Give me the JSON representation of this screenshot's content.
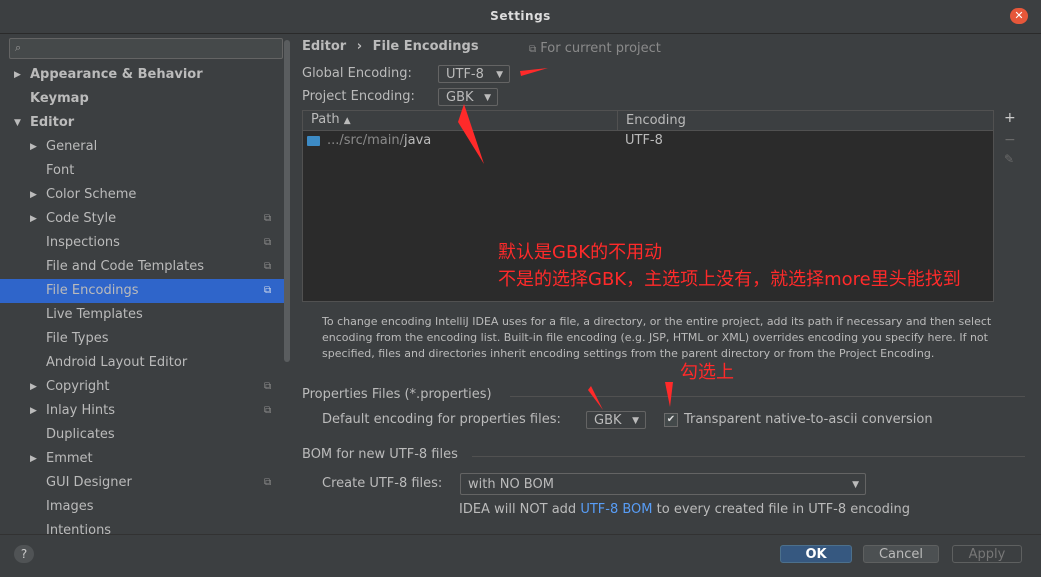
{
  "window": {
    "title": "Settings"
  },
  "sidebar": {
    "items": [
      {
        "label": "Appearance & Behavior"
      },
      {
        "label": "Keymap"
      },
      {
        "label": "Editor"
      },
      {
        "label": "General"
      },
      {
        "label": "Font"
      },
      {
        "label": "Color Scheme"
      },
      {
        "label": "Code Style"
      },
      {
        "label": "Inspections"
      },
      {
        "label": "File and Code Templates"
      },
      {
        "label": "File Encodings"
      },
      {
        "label": "Live Templates"
      },
      {
        "label": "File Types"
      },
      {
        "label": "Android Layout Editor"
      },
      {
        "label": "Copyright"
      },
      {
        "label": "Inlay Hints"
      },
      {
        "label": "Duplicates"
      },
      {
        "label": "Emmet"
      },
      {
        "label": "GUI Designer"
      },
      {
        "label": "Images"
      },
      {
        "label": "Intentions"
      }
    ]
  },
  "breadcrumb": {
    "parent": "Editor",
    "separator": "›",
    "current": "File Encodings",
    "scope": "For current project"
  },
  "global_encoding": {
    "label": "Global Encoding:",
    "value": "UTF-8"
  },
  "project_encoding": {
    "label": "Project Encoding:",
    "value": "GBK"
  },
  "table": {
    "columns": [
      "Path",
      "Encoding"
    ],
    "rows": [
      {
        "path_prefix": ".../src/main/",
        "path_last": "java",
        "encoding": "UTF-8"
      }
    ],
    "tools": {
      "add": "+",
      "remove": "−",
      "edit": "✎"
    }
  },
  "help_text": "To change encoding IntelliJ IDEA uses for a file, a directory, or the entire project, add its path if necessary and then select encoding from the encoding list. Built-in file encoding (e.g. JSP, HTML or XML) overrides encoding you specify here. If not specified, files and directories inherit encoding settings from the parent directory or from the Project Encoding.",
  "properties": {
    "section": "Properties Files (*.properties)",
    "default_label": "Default encoding for properties files:",
    "default_value": "GBK",
    "transparent_label": "Transparent native-to-ascii conversion",
    "transparent_checked": true
  },
  "bom": {
    "section": "BOM for new UTF-8 files",
    "create_label": "Create UTF-8 files:",
    "create_value": "with NO BOM",
    "note_prefix": "IDEA will NOT add ",
    "note_link": "UTF-8 BOM",
    "note_suffix": " to every created file in UTF-8 encoding"
  },
  "buttons": {
    "help": "?",
    "ok": "OK",
    "cancel": "Cancel",
    "apply": "Apply"
  },
  "annotations": {
    "line1": "默认是GBK的不用动",
    "line2": "不是的选择GBK，主选项上没有，就选择more里头能找到",
    "check_note": "勾选上"
  },
  "colors": {
    "accent": "#2f65ca",
    "annotation": "#ff2a2a",
    "link": "#589df6",
    "close": "#e6573a"
  }
}
